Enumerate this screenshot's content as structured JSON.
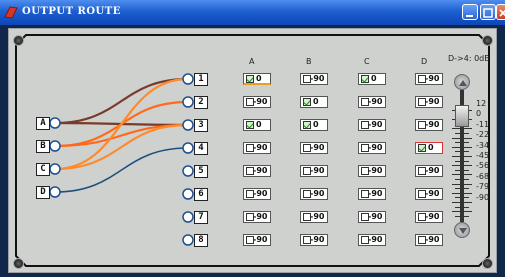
{
  "window": {
    "title": "OUTPUT ROUTE"
  },
  "inputs": [
    "A",
    "B",
    "C",
    "D"
  ],
  "outputs": [
    "1",
    "2",
    "3",
    "4",
    "5",
    "6",
    "7",
    "8"
  ],
  "columns": [
    "A",
    "B",
    "C",
    "D"
  ],
  "gain_label": "D->4:  0dB",
  "scale": [
    "12",
    "0",
    "-11",
    "-22",
    "-34",
    "-45",
    "-56",
    "-68",
    "-79",
    "-90"
  ],
  "matrix": [
    [
      {
        "on": true,
        "v": "0"
      },
      {
        "on": false,
        "v": "-90"
      },
      {
        "on": true,
        "v": "0"
      },
      {
        "on": false,
        "v": "-90"
      }
    ],
    [
      {
        "on": false,
        "v": "-90"
      },
      {
        "on": true,
        "v": "0"
      },
      {
        "on": false,
        "v": "-90"
      },
      {
        "on": false,
        "v": "-90"
      }
    ],
    [
      {
        "on": true,
        "v": "0"
      },
      {
        "on": true,
        "v": "0"
      },
      {
        "on": false,
        "v": "-90"
      },
      {
        "on": false,
        "v": "-90"
      }
    ],
    [
      {
        "on": false,
        "v": "-90"
      },
      {
        "on": false,
        "v": "-90"
      },
      {
        "on": false,
        "v": "-90"
      },
      {
        "on": true,
        "v": "0"
      }
    ],
    [
      {
        "on": false,
        "v": "-90"
      },
      {
        "on": false,
        "v": "-90"
      },
      {
        "on": false,
        "v": "-90"
      },
      {
        "on": false,
        "v": "-90"
      }
    ],
    [
      {
        "on": false,
        "v": "-90"
      },
      {
        "on": false,
        "v": "-90"
      },
      {
        "on": false,
        "v": "-90"
      },
      {
        "on": false,
        "v": "-90"
      }
    ],
    [
      {
        "on": false,
        "v": "-90"
      },
      {
        "on": false,
        "v": "-90"
      },
      {
        "on": false,
        "v": "-90"
      },
      {
        "on": false,
        "v": "-90"
      }
    ],
    [
      {
        "on": false,
        "v": "-90"
      },
      {
        "on": false,
        "v": "-90"
      },
      {
        "on": false,
        "v": "-90"
      },
      {
        "on": false,
        "v": "-90"
      }
    ]
  ],
  "selected_cell": {
    "row": 3,
    "col": 3
  },
  "slider_value_db": 0,
  "routes": [
    {
      "from": "A",
      "to": "1",
      "color": "#7a3a2a"
    },
    {
      "from": "A",
      "to": "3",
      "color": "#7a3a2a"
    },
    {
      "from": "B",
      "to": "2",
      "color": "#ff6a1a"
    },
    {
      "from": "B",
      "to": "3",
      "color": "#ff6a1a"
    },
    {
      "from": "C",
      "to": "1",
      "color": "#ff8a2a"
    },
    {
      "from": "C",
      "to": "3",
      "color": "#ff8a2a"
    },
    {
      "from": "D",
      "to": "4",
      "color": "#1f4f7f"
    }
  ]
}
